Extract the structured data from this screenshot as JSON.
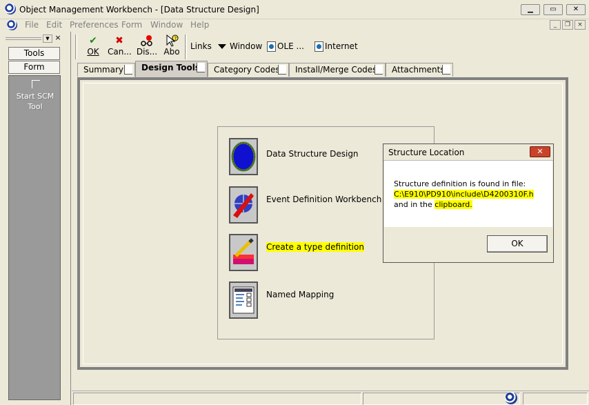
{
  "window": {
    "title": "Object Management Workbench - [Data Structure Design]"
  },
  "menubar": {
    "items": [
      "File",
      "Edit",
      "Preferences",
      "Form",
      "Window",
      "Help"
    ]
  },
  "left_panel": {
    "buttons": [
      "Tools",
      "Form"
    ],
    "items": [
      {
        "label": "Start SCM\nTool",
        "icon": "scm-tool-icon"
      }
    ]
  },
  "toolbar": {
    "buttons": [
      {
        "label": "OK",
        "icon": "checkmark-icon",
        "color": "#1a8a1a"
      },
      {
        "label": "Can...",
        "icon": "x-icon",
        "color": "#d40000"
      },
      {
        "label": "Dis...",
        "icon": "display-icon"
      },
      {
        "label": "Abo",
        "icon": "about-icon"
      }
    ],
    "links": [
      {
        "label": "Links"
      },
      {
        "label": "Window",
        "icon": "dropdown-triangle-icon"
      },
      {
        "label": "OLE ...",
        "icon": "document-icon"
      },
      {
        "label": "Internet",
        "icon": "document-icon"
      }
    ]
  },
  "tabs": [
    {
      "label": "Summary",
      "active": false
    },
    {
      "label": "Design Tools",
      "active": true
    },
    {
      "label": "Category Codes",
      "active": false
    },
    {
      "label": "Install/Merge Codes",
      "active": false
    },
    {
      "label": "Attachments",
      "active": false
    }
  ],
  "design_tools": [
    {
      "label": "Data Structure Design",
      "icon": "data-structure-icon",
      "highlighted": false
    },
    {
      "label": "Event Definition Workbench",
      "icon": "event-definition-icon",
      "highlighted": false
    },
    {
      "label": "Create a type definition",
      "icon": "type-definition-icon",
      "highlighted": true
    },
    {
      "label": "Named Mapping",
      "icon": "named-mapping-icon",
      "highlighted": false
    }
  ],
  "dialog": {
    "title": "Structure Location",
    "line1": "Structure definition is found in file:",
    "path": "C:\\E910\\PD910\\include\\D4200310F.h",
    "line3_prefix": "and in the ",
    "line3_link": "clipboard",
    "line3_suffix": ".",
    "ok_label": "OK"
  },
  "colors": {
    "highlight": "#ffff00",
    "close_button": "#c8432a",
    "frame": "#808080"
  }
}
